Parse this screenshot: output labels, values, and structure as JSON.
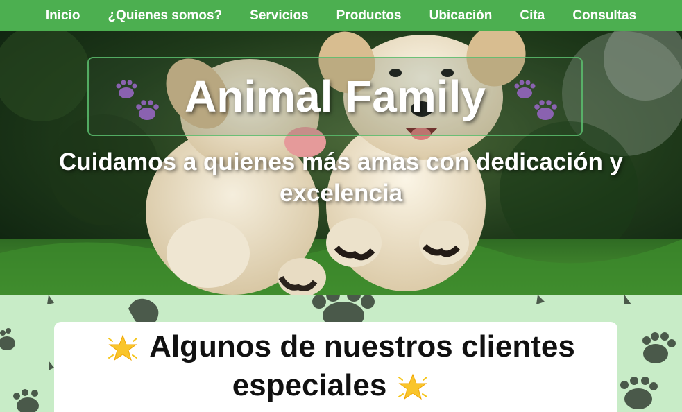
{
  "nav": {
    "items": [
      {
        "label": "Inicio"
      },
      {
        "label": "¿Quienes somos?"
      },
      {
        "label": "Servicios"
      },
      {
        "label": "Productos"
      },
      {
        "label": "Ubicación"
      },
      {
        "label": "Cita"
      },
      {
        "label": "Consultas"
      }
    ]
  },
  "hero": {
    "title": "Animal Family",
    "subtitle_line1": "Cuidamos a quienes más amas con dedicación y",
    "subtitle_line2": "excelencia",
    "paw_color": "#8a62b0",
    "border_color": "#5cbe6e"
  },
  "clients": {
    "title_line1": "Algunos de nuestros clientes",
    "title_line2": "especiales",
    "star_icon": "glowing-star-icon",
    "background": "#c8ecc7",
    "paw_pattern_color": "#3d4a3d"
  },
  "colors": {
    "nav_bg": "#4caf50",
    "nav_text": "#ffffff"
  }
}
